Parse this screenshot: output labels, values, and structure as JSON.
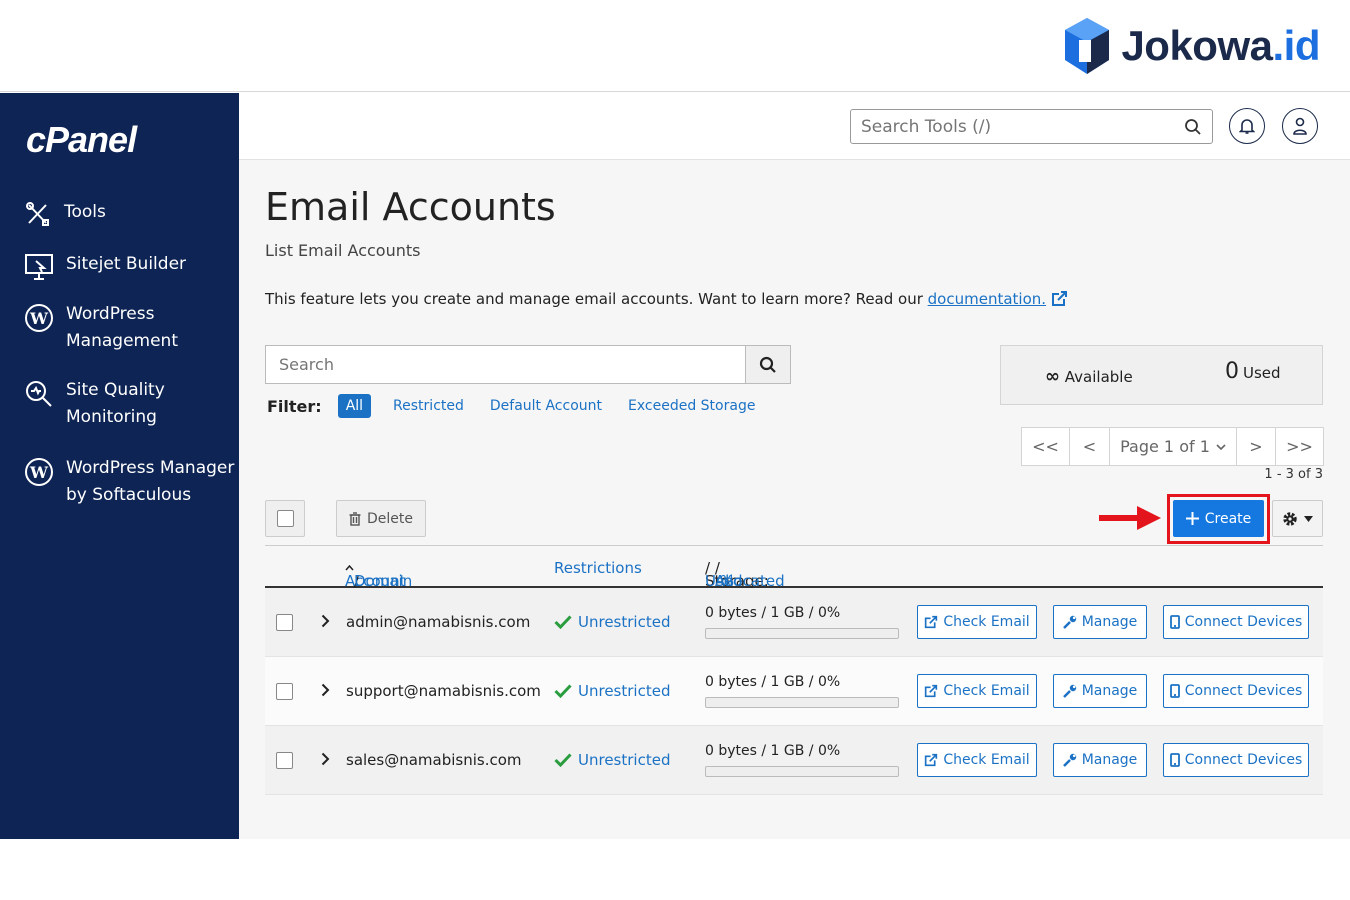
{
  "brand": {
    "name_main": "Jokowa",
    "name_accent": ".id",
    "accent_color": "#1d6fe0"
  },
  "sidebar": {
    "logo": "cPanel",
    "items": [
      {
        "label": "Tools",
        "icon": "tools-icon"
      },
      {
        "label": "Sitejet Builder",
        "icon": "monitor-icon"
      },
      {
        "label": "WordPress\nManagement",
        "icon": "wordpress-icon"
      },
      {
        "label": "Site Quality\nMonitoring",
        "icon": "magnifier-icon"
      },
      {
        "label": "WordPress Manager\nby Softaculous",
        "icon": "wordpress-icon"
      }
    ]
  },
  "topbar": {
    "search_placeholder": "Search Tools (/)"
  },
  "page": {
    "title": "Email Accounts",
    "subtitle": "List Email Accounts",
    "description": "This feature lets you create and manage email accounts. Want to learn more? Read our ",
    "doc_link": "documentation."
  },
  "search": {
    "placeholder": "Search"
  },
  "filter": {
    "label": "Filter:",
    "options": [
      "All",
      "Restricted",
      "Default Account",
      "Exceeded Storage"
    ],
    "selected": "All"
  },
  "quota": {
    "available_symbol": "∞",
    "available_label": "Available",
    "used_value": "0",
    "used_label": "Used"
  },
  "pagination": {
    "first": "<<",
    "prev": "<",
    "page_label": "Page 1 of 1",
    "next": ">",
    "last": ">>",
    "range": "1 - 3 of 3"
  },
  "toolbar": {
    "delete_label": "Delete",
    "create_label": "Create"
  },
  "table": {
    "headers": {
      "account": "Account",
      "sep": "/",
      "domain": "Domain",
      "restrictions": "Restrictions",
      "storage_prefix": "Storage:",
      "used": "Used",
      "allocated": "Allocated",
      "percent": "%"
    },
    "rows": [
      {
        "email": "admin@namabisnis.com",
        "restriction": "Unrestricted",
        "storage": "0 bytes / 1 GB / 0%",
        "usage_fraction": 0
      },
      {
        "email": "support@namabisnis.com",
        "restriction": "Unrestricted",
        "storage": "0 bytes / 1 GB / 0%",
        "usage_fraction": 0
      },
      {
        "email": "sales@namabisnis.com",
        "restriction": "Unrestricted",
        "storage": "0 bytes / 1 GB / 0%",
        "usage_fraction": 0
      }
    ],
    "actions": {
      "check_email": "Check Email",
      "manage": "Manage",
      "connect_devices": "Connect Devices"
    }
  },
  "colors": {
    "sidebar_bg": "#0e2454",
    "primary": "#1478e0",
    "link": "#1b72c5",
    "highlight": "#e3141b",
    "success": "#2a9d3f"
  }
}
